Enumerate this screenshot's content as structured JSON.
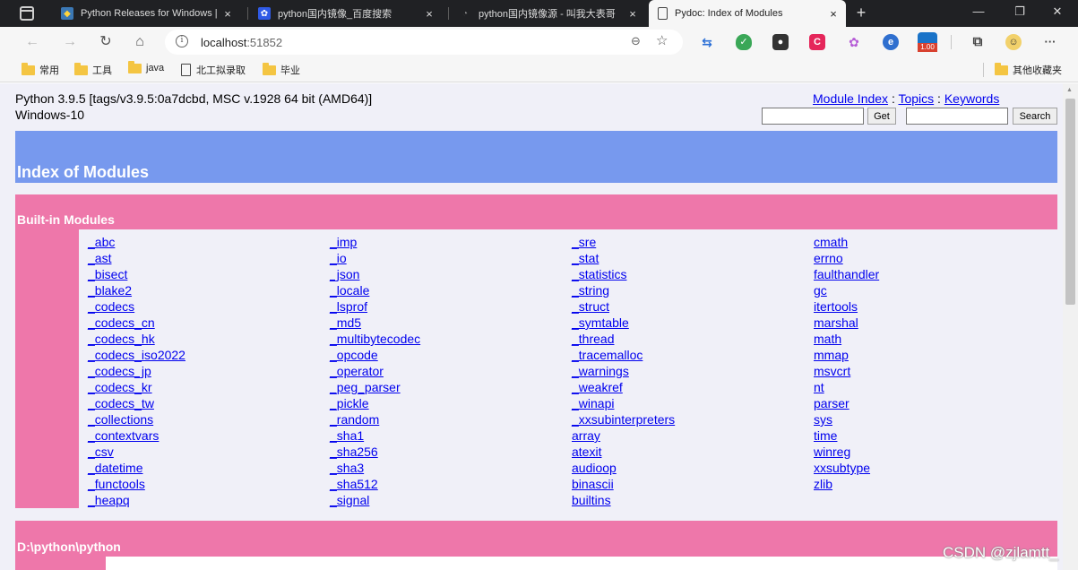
{
  "browser": {
    "tabs": [
      {
        "title": "Python Releases for Windows | P",
        "close": "×",
        "favicon": "python-logo-icon"
      },
      {
        "title": "python国内镜像_百度搜索",
        "close": "×",
        "favicon": "baidu-paw-icon"
      },
      {
        "title": "python国内镜像源 - 叫我大表哥",
        "close": "×",
        "favicon": "site-logo-icon"
      },
      {
        "title": "Pydoc: Index of Modules",
        "close": "×",
        "favicon": "page-icon",
        "active": true
      }
    ],
    "new_tab": "+",
    "window_controls": {
      "minimize": "—",
      "restore": "❐",
      "close": "✕"
    },
    "address": {
      "host": "localhost",
      "port": ":51852"
    },
    "bookmarks": [
      {
        "label": "常用",
        "icon": "folder-icon"
      },
      {
        "label": "工具",
        "icon": "folder-icon"
      },
      {
        "label": "java",
        "icon": "folder-icon"
      },
      {
        "label": "北工拟录取",
        "icon": "page-icon"
      },
      {
        "label": "毕业",
        "icon": "folder-icon"
      }
    ],
    "other_bookmarks": "其他收藏夹",
    "extension_badge": "1.00",
    "more_menu": "···"
  },
  "page": {
    "python_version": "Python 3.9.5 [tags/v3.9.5:0a7dcbd, MSC v.1928 64 bit (AMD64)]",
    "os": "Windows-10",
    "links": {
      "module_index": "Module Index",
      "topics": "Topics",
      "keywords": "Keywords",
      "separator": " : "
    },
    "get_button": "Get",
    "search_button": "Search",
    "title": "Index of Modules",
    "builtin_title": "Built-in Modules",
    "builtin_columns": [
      [
        "_abc",
        "_ast",
        "_bisect",
        "_blake2",
        "_codecs",
        "_codecs_cn",
        "_codecs_hk",
        "_codecs_iso2022",
        "_codecs_jp",
        "_codecs_kr",
        "_codecs_tw",
        "_collections",
        "_contextvars",
        "_csv",
        "_datetime",
        "_functools",
        "_heapq"
      ],
      [
        "_imp",
        "_io",
        "_json",
        "_locale",
        "_lsprof",
        "_md5",
        "_multibytecodec",
        "_opcode",
        "_operator",
        "_peg_parser",
        "_pickle",
        "_random",
        "_sha1",
        "_sha256",
        "_sha3",
        "_sha512",
        "_signal"
      ],
      [
        "_sre",
        "_stat",
        "_statistics",
        "_string",
        "_struct",
        "_symtable",
        "_thread",
        "_tracemalloc",
        "_warnings",
        "_weakref",
        "_winapi",
        "_xxsubinterpreters",
        "array",
        "atexit",
        "audioop",
        "binascii",
        "builtins"
      ],
      [
        "cmath",
        "errno",
        "faulthandler",
        "gc",
        "itertools",
        "marshal",
        "math",
        "mmap",
        "msvcrt",
        "nt",
        "parser",
        "sys",
        "time",
        "winreg",
        "xxsubtype",
        "zlib"
      ]
    ],
    "path_title": "D:\\python\\python"
  },
  "watermark": "CSDN @zjlamtt_",
  "colors": {
    "index_banner": "#7799ee",
    "section_header": "#ee77aa",
    "link": "#0000ee",
    "page_bg": "#f0f0f8"
  }
}
